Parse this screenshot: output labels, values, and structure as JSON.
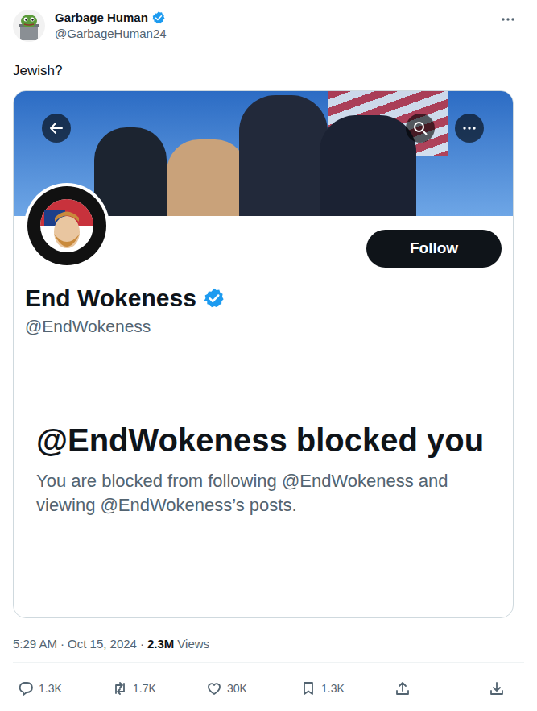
{
  "author": {
    "name": "Garbage Human",
    "handle": "@GarbageHuman24",
    "verified": true
  },
  "text": "Jewish?",
  "card": {
    "name": "End Wokeness",
    "verified": true,
    "handle": "@EndWokeness",
    "follow": "Follow",
    "blocked_title": "@EndWokeness blocked you",
    "blocked_message": "You are blocked from following @EndWokeness and viewing @EndWokeness’s posts."
  },
  "meta": {
    "time": "5:29 AM",
    "separator": "·",
    "date": "Oct 15, 2024",
    "views": "2.3M",
    "views_label": "Views"
  },
  "actions": [
    {
      "kind": "reply",
      "count": "1.3K"
    },
    {
      "kind": "repost",
      "count": "1.7K"
    },
    {
      "kind": "like",
      "count": "30K"
    },
    {
      "kind": "bookmark",
      "count": "1.3K"
    },
    {
      "kind": "share"
    },
    {
      "kind": "download"
    }
  ]
}
